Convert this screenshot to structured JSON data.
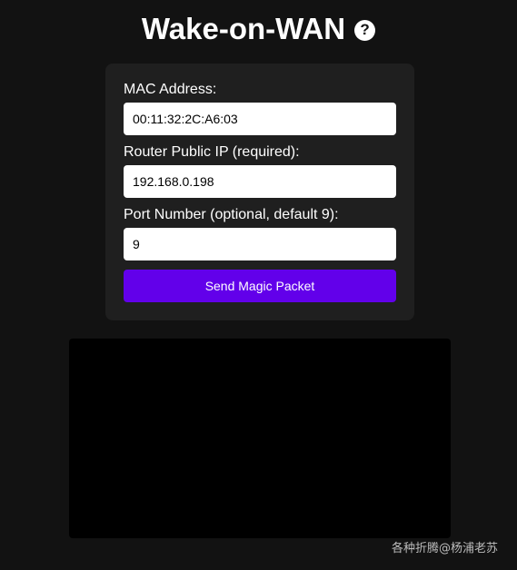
{
  "header": {
    "title": "Wake-on-WAN",
    "help_icon": "question-circle-icon",
    "help_glyph": "?"
  },
  "form": {
    "mac": {
      "label": "MAC Address:",
      "value": "00:11:32:2C:A6:03"
    },
    "ip": {
      "label": "Router Public IP (required):",
      "value": "192.168.0.198"
    },
    "port": {
      "label": "Port Number (optional, default 9):",
      "value": "9"
    },
    "submit_label": "Send Magic Packet"
  },
  "output": {
    "text": ""
  },
  "watermark": "各种折腾@杨浦老苏",
  "colors": {
    "background": "#121212",
    "card": "#1f1f1f",
    "accent": "#6200ea",
    "output": "#000000"
  }
}
